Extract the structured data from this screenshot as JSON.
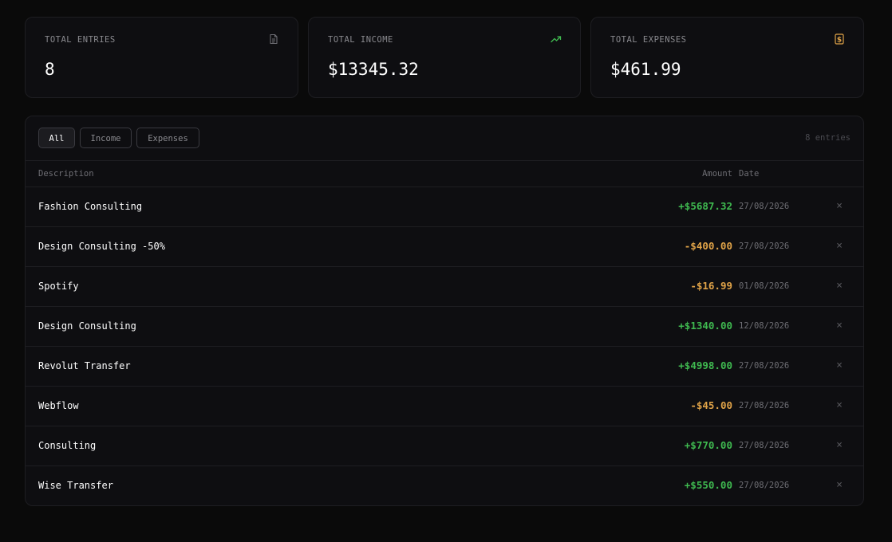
{
  "stats": {
    "entries": {
      "label": "TOTAL ENTRIES",
      "value": "8",
      "icon": "document-icon"
    },
    "income": {
      "label": "TOTAL INCOME",
      "value": "$13345.32",
      "icon": "trending-up-icon",
      "color": "#3fb950"
    },
    "expenses": {
      "label": "TOTAL EXPENSES",
      "value": "$461.99",
      "icon": "dollar-receipt-icon",
      "color": "#e0a348"
    }
  },
  "filters": {
    "all": "All",
    "income": "Income",
    "expenses": "Expenses",
    "selected": "All"
  },
  "entry_count": "8 entries",
  "columns": {
    "description": "Description",
    "amount": "Amount",
    "date": "Date"
  },
  "rows": [
    {
      "description": "Fashion Consulting",
      "amount": "+$5687.32",
      "type": "income",
      "date": "27/08/2026",
      "delete": "×"
    },
    {
      "description": "Design Consulting -50%",
      "amount": "-$400.00",
      "type": "expense",
      "date": "27/08/2026",
      "delete": "×"
    },
    {
      "description": "Spotify",
      "amount": "-$16.99",
      "type": "expense",
      "date": "01/08/2026",
      "delete": "×"
    },
    {
      "description": "Design Consulting",
      "amount": "+$1340.00",
      "type": "income",
      "date": "12/08/2026",
      "delete": "×"
    },
    {
      "description": "Revolut Transfer",
      "amount": "+$4998.00",
      "type": "income",
      "date": "27/08/2026",
      "delete": "×"
    },
    {
      "description": "Webflow",
      "amount": "-$45.00",
      "type": "expense",
      "date": "27/08/2026",
      "delete": "×"
    },
    {
      "description": "Consulting",
      "amount": "+$770.00",
      "type": "income",
      "date": "27/08/2026",
      "delete": "×"
    },
    {
      "description": "Wise Transfer",
      "amount": "+$550.00",
      "type": "income",
      "date": "27/08/2026",
      "delete": "×"
    }
  ]
}
